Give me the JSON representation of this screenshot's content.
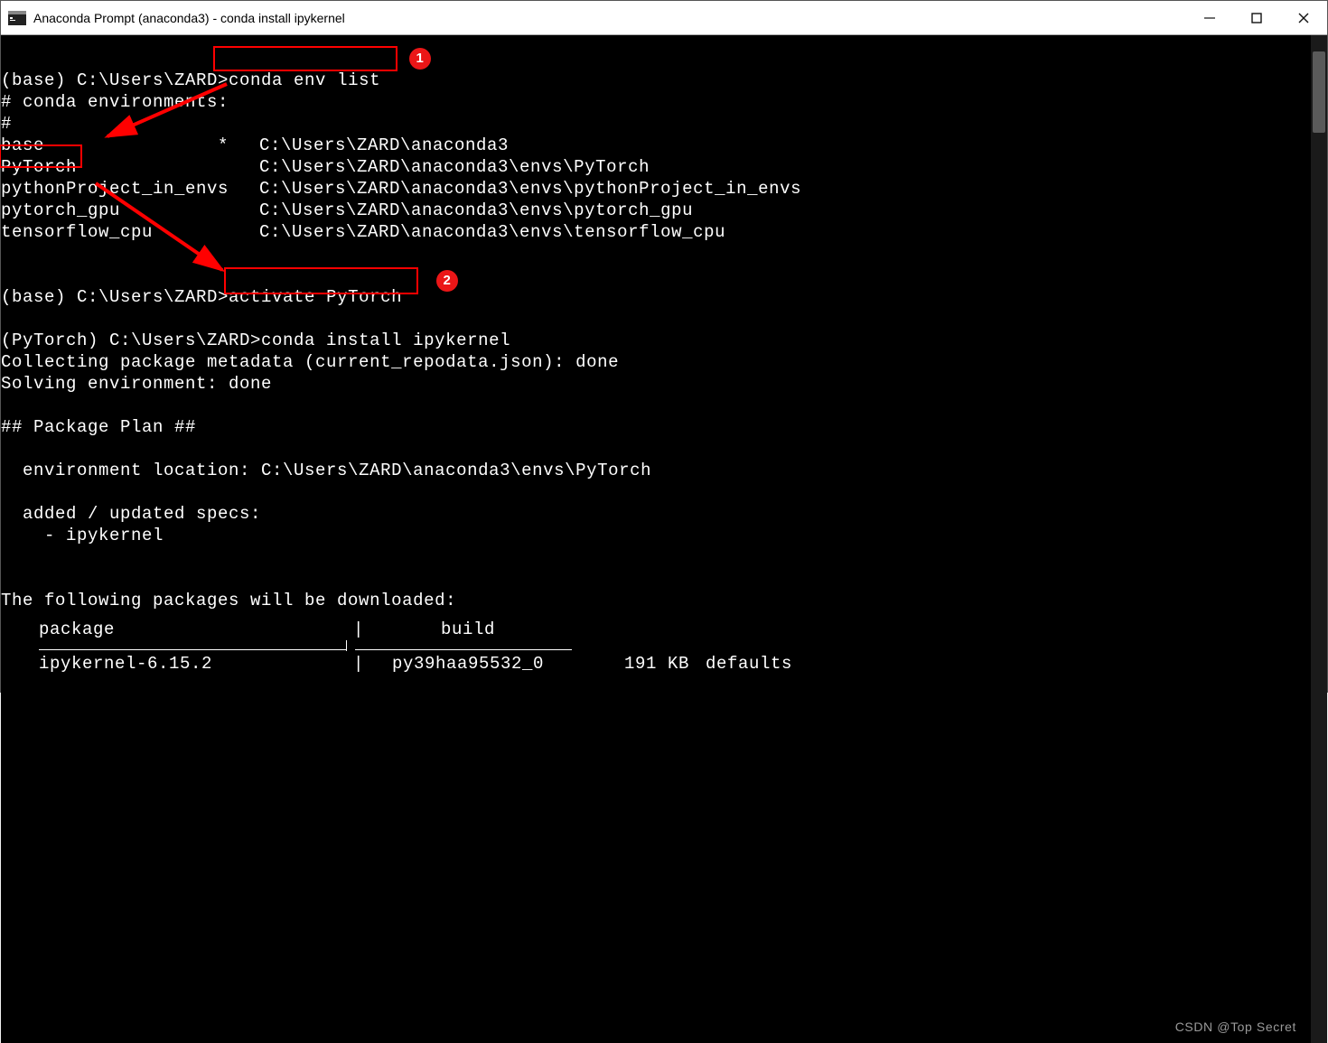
{
  "titlebar": {
    "title": "Anaconda Prompt (anaconda3) - conda  install ipykernel"
  },
  "annotations": {
    "badge1": "1",
    "badge2": "2"
  },
  "terminal": {
    "prompt1_prefix": "(base) C:\\Users\\ZARD>",
    "cmd1": "conda env list",
    "env_header1": "# conda environments:",
    "env_header2": "#",
    "envs": [
      {
        "name": "base",
        "marker": "*",
        "path": "C:\\Users\\ZARD\\anaconda3"
      },
      {
        "name": "PyTorch",
        "marker": " ",
        "path": "C:\\Users\\ZARD\\anaconda3\\envs\\PyTorch"
      },
      {
        "name": "pythonProject_in_envs",
        "marker": " ",
        "path": "C:\\Users\\ZARD\\anaconda3\\envs\\pythonProject_in_envs"
      },
      {
        "name": "pytorch_gpu",
        "marker": " ",
        "path": "C:\\Users\\ZARD\\anaconda3\\envs\\pytorch_gpu"
      },
      {
        "name": "tensorflow_cpu",
        "marker": " ",
        "path": "C:\\Users\\ZARD\\anaconda3\\envs\\tensorflow_cpu"
      }
    ],
    "prompt2_prefix": "(base) C:\\Users\\ZARD>",
    "cmd2": "activate PyTorch",
    "prompt3_prefix": "(PyTorch) C:\\Users\\ZARD>",
    "cmd3": "conda install ipykernel",
    "collecting": "Collecting package metadata (current_repodata.json): done",
    "solving": "Solving environment: done",
    "plan_header": "## Package Plan ##",
    "env_location_label": "  environment location: ",
    "env_location_value": "C:\\Users\\ZARD\\anaconda3\\envs\\PyTorch",
    "added_specs": "  added / updated specs:",
    "spec_item": "    - ipykernel",
    "download_header": "The following packages will be downloaded:",
    "table_header": {
      "c1": "package",
      "c2": "build"
    },
    "table_rows": [
      {
        "c1": "ipykernel-6.15.2",
        "c2": "py39haa95532_0",
        "c3": "191 KB",
        "c4": "defaults"
      }
    ]
  },
  "watermark": "CSDN @Top Secret"
}
